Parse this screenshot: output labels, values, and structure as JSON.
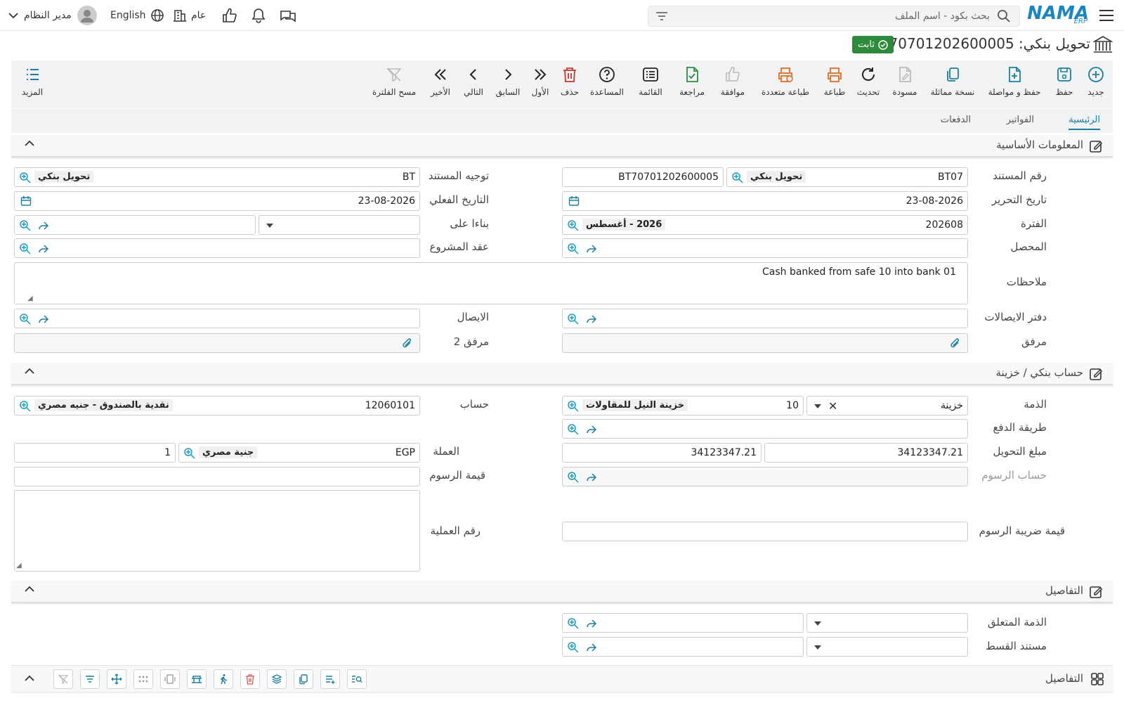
{
  "topbar": {
    "search_placeholder": "بحث بكود - اسم الملف",
    "language_label": "English",
    "scope_label": "عام",
    "user_label": "مدير النظام",
    "logo_text": "NAMA",
    "logo_sub": "ERP"
  },
  "header": {
    "title": "تحويل بنكي: BT70701202600005",
    "status": "ثابت",
    "status_color": "#2e8b3e"
  },
  "toolbar": {
    "new": "جديد",
    "save": "حفظ",
    "save_continue": "حفظ و مواصلة",
    "duplicate": "نسخة مماثلة",
    "draft": "مسودة",
    "refresh": "تحديث",
    "print": "طباعة",
    "multi_print": "طباعة متعددة",
    "approve": "موافقة",
    "review": "مراجعة",
    "list": "القائمة",
    "help": "المساعدة",
    "delete": "حذف",
    "first": "الأول",
    "previous": "السابق",
    "next": "التالي",
    "last": "الأخير",
    "clear_filter": "مسح الفلترة",
    "more": "المزيد"
  },
  "tabs": [
    "الرئيسية",
    "الفواتير",
    "الدفعات"
  ],
  "sections": {
    "basic": "المعلومات الأساسية",
    "bank": "حساب بنكي / خزينة",
    "details": "التفاصيل",
    "details_grid": "التفاصيل"
  },
  "labels": {
    "doc_number": "رقم المستند",
    "doc_direction": "توجيه المستند",
    "edit_date": "تاريخ التحرير",
    "actual_date": "التاريخ الفعلي",
    "period": "الفترة",
    "based_on": "بناءا على",
    "collector": "المحصل",
    "project_contract": "عقد المشروع",
    "notes": "ملاحظات",
    "receipt_book": "دفتر الايصالات",
    "receipt": "الايصال",
    "attachment": "مرفق",
    "attachment2": "مرفق 2",
    "liability": "الذمة",
    "account": "حساب",
    "payment_method": "طريقة الدفع",
    "transfer_amount": "مبلغ التحويل",
    "currency": "العملة",
    "fees_account": "حساب الرسوم",
    "fees_value": "قيمة الرسوم",
    "fees_tax_value": "قيمة ضريبة الرسوم",
    "operation_number": "رقم العملية",
    "related_liability": "الذمة المتعلق",
    "installment_doc": "مستند القسط"
  },
  "values": {
    "doc_code": "BT07",
    "doc_type_tag": "تحويل بنكي",
    "doc_number": "BT70701202600005",
    "direction_code": "BT",
    "direction_tag": "تحويل بنكي",
    "edit_date": "23-08-2026",
    "actual_date": "23-08-2026",
    "period_code": "202608",
    "period_tag": "2026 - أغسطس",
    "notes": "Cash banked from safe 10 into bank 01",
    "liability_type": "خزينة",
    "liability_code": "10",
    "liability_tag": "خزينة النيل للمقاولات",
    "account_code": "12060101",
    "account_tag": "نقدية بالصندوق - جنيه مصري",
    "amount": "34123347.21",
    "amount_local": "34123347.21",
    "currency_code": "EGP",
    "currency_tag": "جنية مصري",
    "rate": "1"
  }
}
